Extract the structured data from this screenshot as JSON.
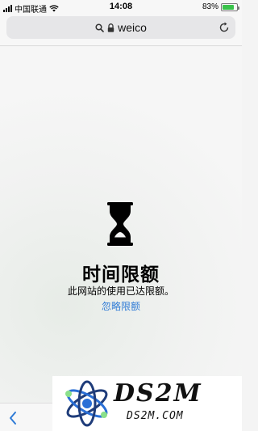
{
  "status_bar": {
    "carrier": "中国联通",
    "time": "14:08",
    "battery_percent": "83%",
    "battery_level": 0.83,
    "battery_color": "#3ac34b"
  },
  "url_bar": {
    "url": "weico",
    "icons": [
      "search-icon",
      "lock-icon",
      "reload-icon"
    ]
  },
  "screen_time": {
    "icon": "hourglass-icon",
    "title": "时间限额",
    "description": "此网站的使用已达限额。",
    "ignore_link": "忽略限额",
    "link_color": "#2f7bd6"
  },
  "toolbar": {
    "icons": [
      "back-icon"
    ]
  },
  "watermark": {
    "logo_text": "DS2M",
    "domain_text": "DS2M.COM"
  }
}
